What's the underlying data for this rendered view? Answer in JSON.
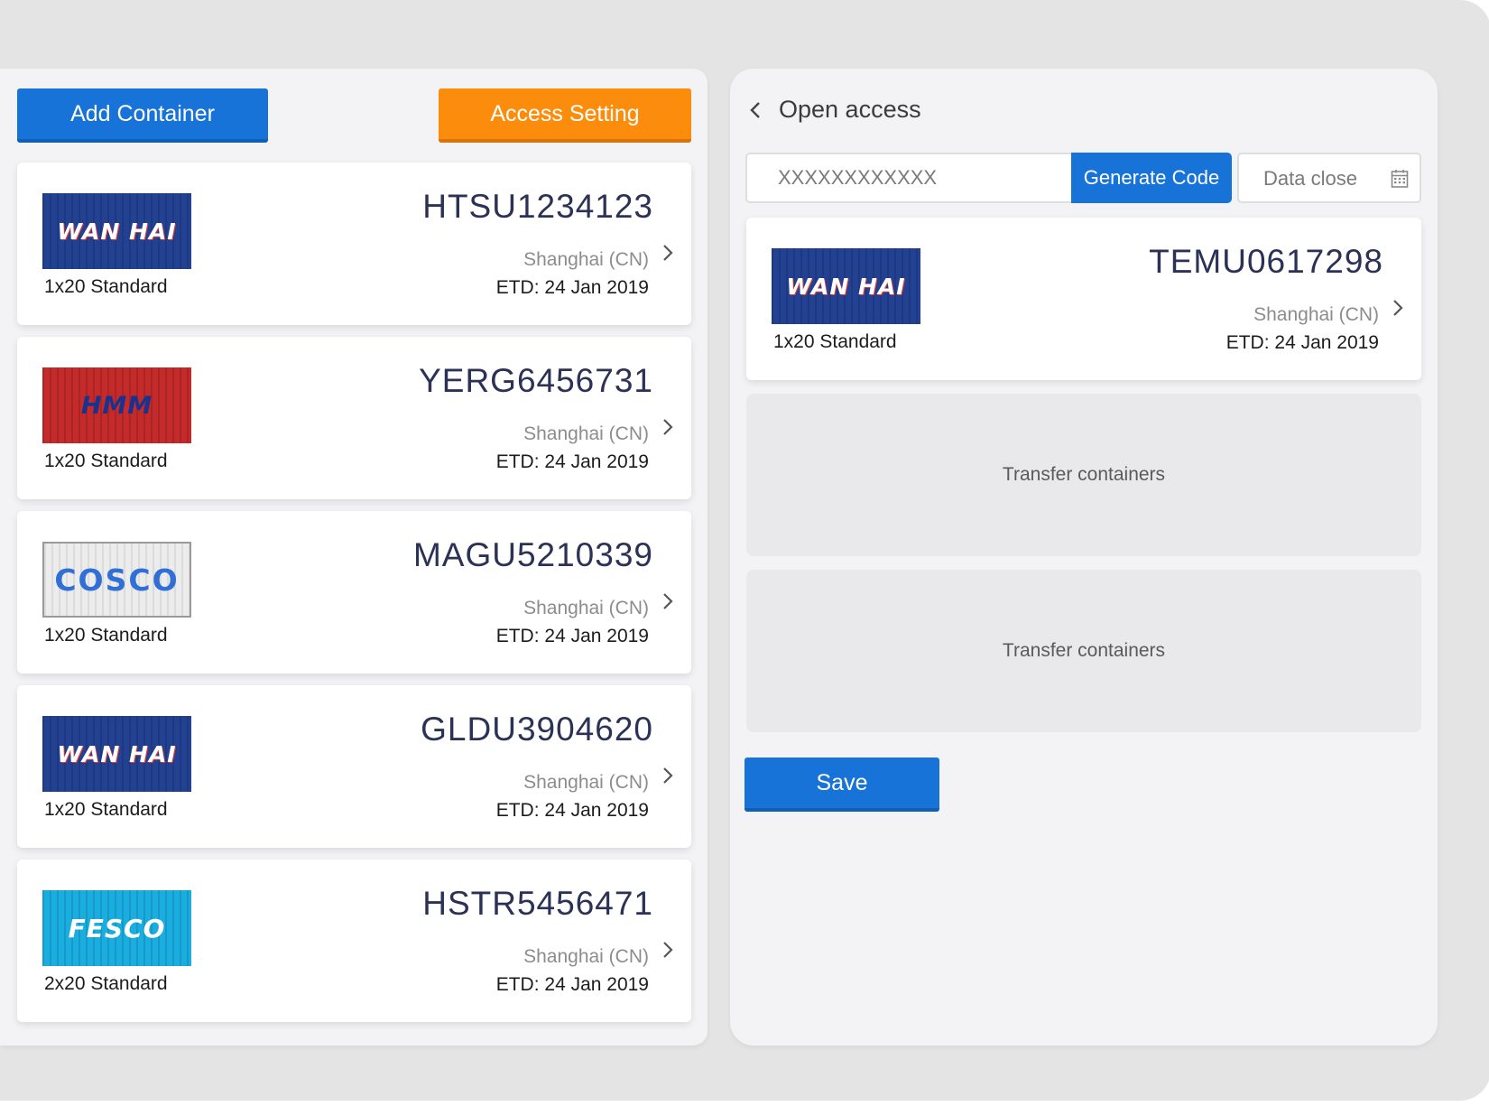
{
  "left_panel": {
    "add_container_label": "Add Container",
    "access_setting_label": "Access Setting",
    "containers": [
      {
        "logo": "WAN HAI",
        "code": "HTSU1234123",
        "size": "1x20 Standard",
        "origin": "Shanghai (CN)",
        "etd": "ETD: 24 Jan 2019"
      },
      {
        "logo": "HMM",
        "code": "YERG6456731",
        "size": "1x20 Standard",
        "origin": "Shanghai (CN)",
        "etd": "ETD: 24 Jan 2019"
      },
      {
        "logo": "COSCO",
        "code": "MAGU5210339",
        "size": "1x20 Standard",
        "origin": "Shanghai (CN)",
        "etd": "ETD: 24 Jan 2019"
      },
      {
        "logo": "WAN HAI",
        "code": "GLDU3904620",
        "size": "1x20 Standard",
        "origin": "Shanghai (CN)",
        "etd": "ETD: 24 Jan 2019"
      },
      {
        "logo": "FESCO",
        "code": "HSTR5456471",
        "size": "2x20 Standard",
        "origin": "Shanghai (CN)",
        "etd": "ETD: 24 Jan 2019"
      }
    ]
  },
  "right_panel": {
    "title": "Open access",
    "code_value": "XXXXXXXXXXXX",
    "generate_label": "Generate Code",
    "date_placeholder": "Data close",
    "selected": {
      "logo": "WAN HAI",
      "code": "TEMU0617298",
      "size": "1x20 Standard",
      "origin": "Shanghai (CN)",
      "etd": "ETD: 24 Jan 2019"
    },
    "drop_zones": [
      "Transfer containers",
      "Transfer containers"
    ],
    "save_label": "Save"
  },
  "colors": {
    "primary": "#1773d8",
    "accent": "#fc8d0c",
    "wanhai": "#234193",
    "hmm": "#c42a2a",
    "fesco": "#1aaee0"
  }
}
